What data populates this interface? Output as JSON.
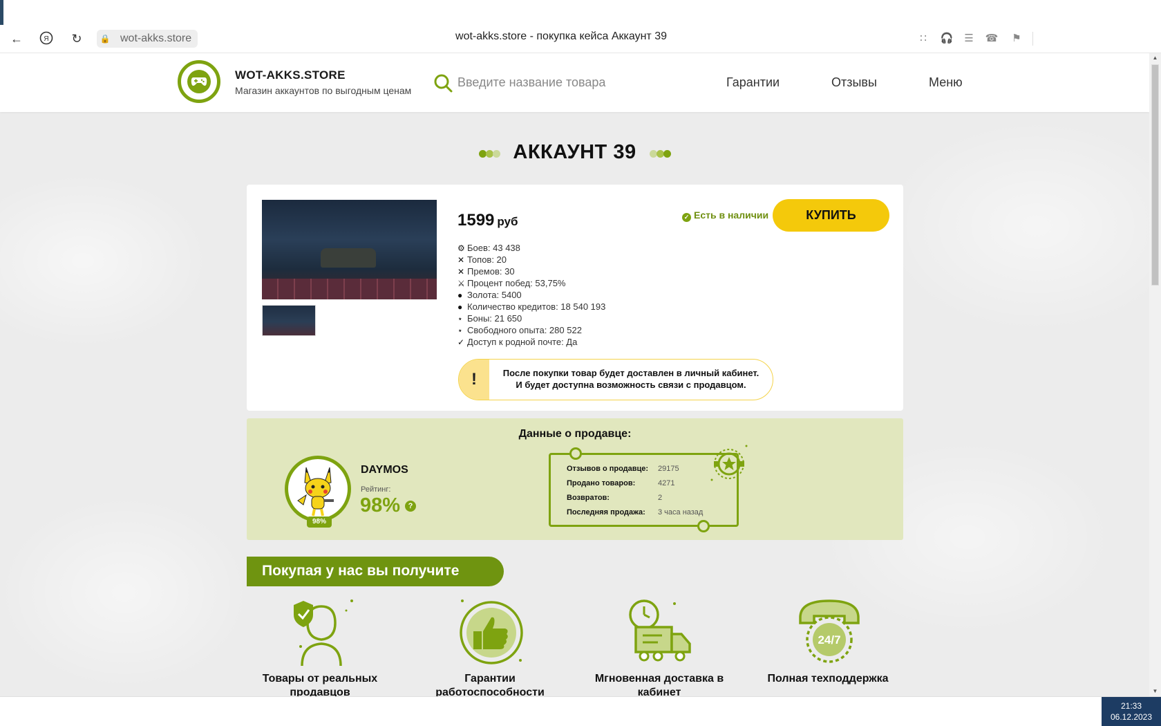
{
  "browser": {
    "url": "wot-akks.store",
    "tab_title": "wot-akks.store - покупка кейса Аккаунт 39"
  },
  "header": {
    "brand_name": "WOT-AKKS.STORE",
    "brand_tagline": "Магазин аккаунтов по выгодным ценам",
    "search_placeholder": "Введите название товара",
    "nav": [
      "Гарантии",
      "Отзывы",
      "Меню"
    ]
  },
  "product": {
    "title": "АККАУНТ 39",
    "price": "1599",
    "currency": "руб",
    "availability": "Есть в наличии",
    "buy_label": "КУПИТЬ",
    "stats": [
      {
        "icon": "battle-icon",
        "text": "Боев: 43 438"
      },
      {
        "icon": "cross-icon",
        "text": "Топов: 20"
      },
      {
        "icon": "cross-icon",
        "text": "Премов: 30"
      },
      {
        "icon": "trophy-icon",
        "text": "Процент побед: 53,75%"
      },
      {
        "icon": "moneybag-icon",
        "text": "Золота: 5400"
      },
      {
        "icon": "moneybag-icon",
        "text": "Количество кредитов: 18 540 193"
      },
      {
        "icon": "star-icon",
        "text": "Боны: 21 650"
      },
      {
        "icon": "star-icon",
        "text": "Свободного опыта: 280 522"
      },
      {
        "icon": "check-icon",
        "text": "Доступ к родной почте: Да"
      }
    ],
    "notice_line1": "После покупки товар будет доставлен в личный кабинет.",
    "notice_line2": "И будет доступна возможность связи с продавцом.",
    "notice_mark": "!"
  },
  "seller": {
    "section_title": "Данные о продавце:",
    "name": "DAYMOS",
    "rating_label": "Рейтинг:",
    "rating": "98%",
    "avatar_badge": "98%",
    "help": "?",
    "info": [
      {
        "label": "Отзывов о продавце:",
        "value": "29175"
      },
      {
        "label": "Продано товаров:",
        "value": "4271"
      },
      {
        "label": "Возвратов:",
        "value": "2"
      },
      {
        "label": "Последняя продажа:",
        "value": "3 часа назад"
      }
    ]
  },
  "benefits": {
    "heading": "Покупая у нас вы получите",
    "items": [
      {
        "label": "Товары от реальных продавцов",
        "icon": "seller-shield-icon"
      },
      {
        "label": "Гарантии работоспособности",
        "icon": "thumbs-up-icon"
      },
      {
        "label": "Мгновенная доставка в кабинет",
        "icon": "delivery-truck-icon"
      },
      {
        "label": "Полная техподдержка",
        "icon": "support-24-7-icon"
      }
    ],
    "support_badge": "24/7"
  },
  "taskbar": {
    "time": "21:33",
    "date": "06.12.2023"
  },
  "colors": {
    "accent_green": "#7ea310",
    "buy_yellow": "#f4c90b",
    "seller_panel_bg": "#e1e7be"
  }
}
